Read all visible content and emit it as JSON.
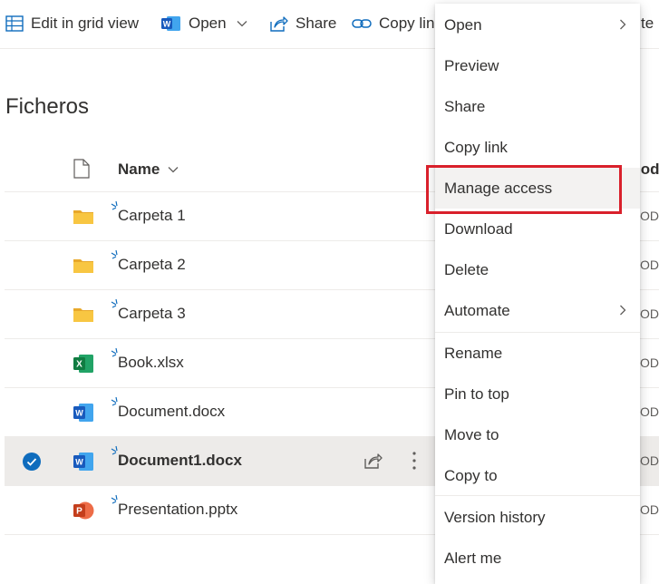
{
  "toolbar": {
    "edit_grid": "Edit in grid view",
    "open": "Open",
    "share": "Share",
    "copy_link": "Copy lin",
    "right_partial": "te"
  },
  "page": {
    "title": "Ficheros"
  },
  "table": {
    "name_header": "Name",
    "modified_header_partial": "lod",
    "rows": [
      {
        "name": "Carpeta 1",
        "type": "folder",
        "modified": "OD"
      },
      {
        "name": "Carpeta 2",
        "type": "folder",
        "modified": "OD"
      },
      {
        "name": "Carpeta 3",
        "type": "folder",
        "modified": "OD"
      },
      {
        "name": "Book.xlsx",
        "type": "excel",
        "modified": "OD"
      },
      {
        "name": "Document.docx",
        "type": "word",
        "modified": "OD"
      },
      {
        "name": "Document1.docx",
        "type": "word",
        "modified": "OD",
        "selected": true
      },
      {
        "name": "Presentation.pptx",
        "type": "powerpoint",
        "modified": "OD"
      }
    ]
  },
  "context_menu": {
    "items": [
      {
        "label": "Open",
        "submenu": true
      },
      {
        "label": "Preview"
      },
      {
        "label": "Share"
      },
      {
        "label": "Copy link"
      },
      {
        "label": "Manage access",
        "highlighted": true
      },
      {
        "label": "Download"
      },
      {
        "label": "Delete"
      },
      {
        "label": "Automate",
        "submenu": true
      },
      {
        "label": "Rename"
      },
      {
        "label": "Pin to top"
      },
      {
        "label": "Move to"
      },
      {
        "label": "Copy to"
      },
      {
        "label": "Version history"
      },
      {
        "label": "Alert me"
      }
    ]
  },
  "colors": {
    "accent": "#0f6cbd",
    "highlight_border": "#d9202b",
    "selected_row": "#edebe9",
    "folder": "#f8c642",
    "excel": "#107c41",
    "word": "#185abd",
    "powerpoint": "#c43e1c"
  }
}
